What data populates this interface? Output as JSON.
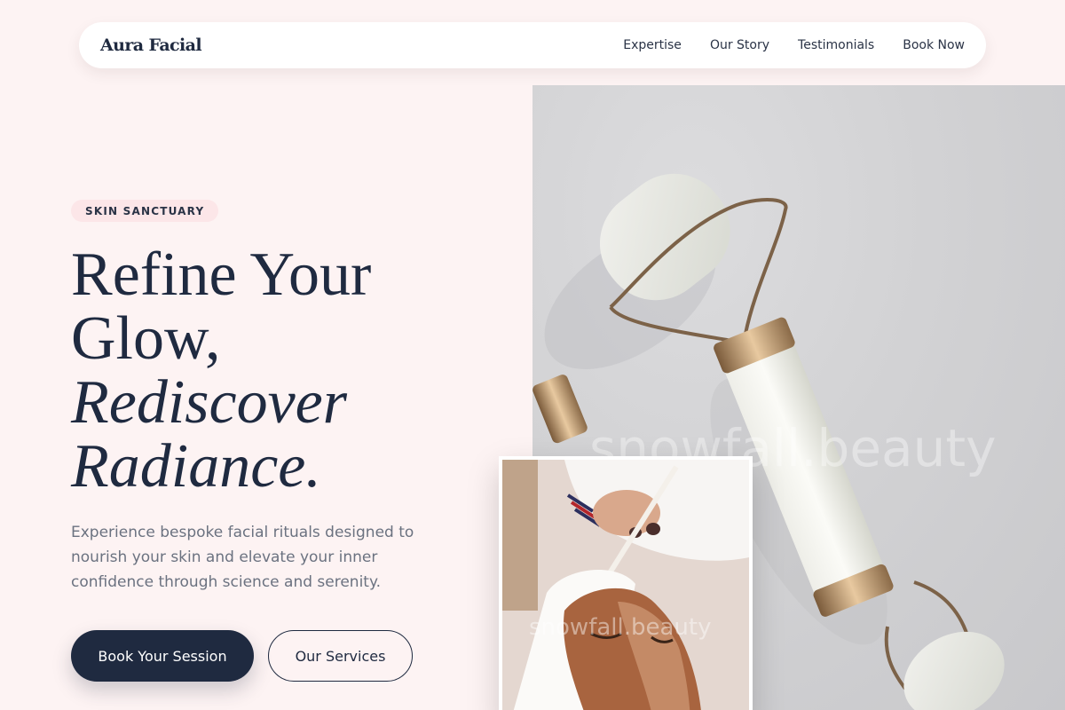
{
  "nav": {
    "brand": "Aura Facial",
    "links": [
      "Expertise",
      "Our Story",
      "Testimonials",
      "Book Now"
    ]
  },
  "hero": {
    "badge": "SKIN SANCTUARY",
    "headline": {
      "line1": "Refine Your",
      "line2": "Glow,",
      "line3": "Rediscover",
      "line4": "Radiance."
    },
    "description": "Experience bespoke facial rituals designed to nourish your skin and elevate your inner confidence through science and serenity.",
    "primary_button": "Book Your Session",
    "secondary_button": "Our Services"
  },
  "images": {
    "hero_image_subject": "jade-face-roller-photo",
    "inset_image_subject": "facial-mask-application-photo",
    "watermark": "snowfall.beauty"
  },
  "colors": {
    "background": "#fdf3f3",
    "navy": "#1f2a40",
    "badge_bg": "#fce6e8",
    "body_text": "#6b7280"
  }
}
